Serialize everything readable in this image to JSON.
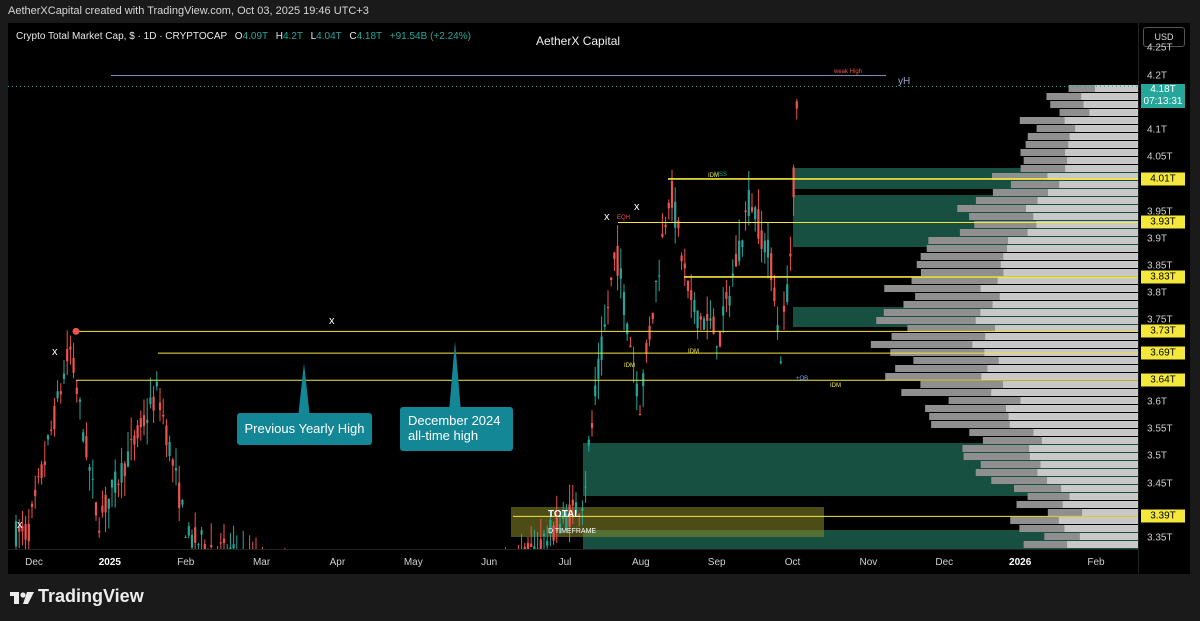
{
  "caption": "AetherXCapital created with TradingView.com, Oct 03, 2025 19:46 UTC+3",
  "legend": {
    "symbol": "Crypto Total Market Cap, $ · 1D · CRYPTOCAP",
    "o_key": "O",
    "o_val": "4.09T",
    "h_key": "H",
    "h_val": "4.2T",
    "l_key": "L",
    "l_val": "4.04T",
    "c_key": "C",
    "c_val": "4.18T",
    "change": "+91.54B (+2.24%)"
  },
  "watermark": "AetherX Capital",
  "currency_button": "USD",
  "footer_brand": "TradingView",
  "colors": {
    "up": "#26a69a",
    "down": "#ef5350",
    "level": "#f5e83c",
    "zone": "#1b5e4c",
    "callout": "#138796",
    "volume_profile": "#9e9e9e",
    "total_box": "#8a8a2a"
  },
  "chart_data": {
    "type": "candlestick",
    "timeframe": "1D",
    "ylim": [
      3.33,
      4.28
    ],
    "y_ticks": [
      "4.25T",
      "4.2T",
      "4.1T",
      "4.05T",
      "3.95T",
      "3.9T",
      "3.85T",
      "3.8T",
      "3.75T",
      "3.6T",
      "3.55T",
      "3.5T",
      "3.45T",
      "3.35T"
    ],
    "x_ticks": [
      "Dec",
      "2025",
      "Feb",
      "Mar",
      "Apr",
      "May",
      "Jun",
      "Jul",
      "Aug",
      "Sep",
      "Oct",
      "Nov",
      "Dec",
      "2026",
      "Feb"
    ],
    "last_price": "4.18T",
    "countdown": "07:13:31",
    "price_levels": [
      {
        "value": 4.01,
        "label": "4.01T"
      },
      {
        "value": 3.93,
        "label": "3.93T"
      },
      {
        "value": 3.83,
        "label": "3.83T"
      },
      {
        "value": 3.73,
        "label": "3.73T"
      },
      {
        "value": 3.69,
        "label": "3.69T"
      },
      {
        "value": 3.64,
        "label": "3.64T"
      },
      {
        "value": 3.39,
        "label": "3.39T"
      }
    ],
    "yearly_high_label": "yH",
    "weak_high_label": "weak High",
    "callouts": [
      {
        "text_lines": [
          "Previous Yearly High"
        ]
      },
      {
        "text_lines": [
          "December 2024",
          "all-time high"
        ]
      }
    ],
    "annotations": [
      "MSS",
      "EQH",
      "IDM",
      "IDM",
      "IDM",
      "+OB",
      "IDM"
    ],
    "x_markers": [
      "x",
      "x",
      "x",
      "x",
      "x"
    ],
    "total_box": {
      "title": "TOTAL",
      "subtitle": "D TIMEFRAME"
    }
  }
}
